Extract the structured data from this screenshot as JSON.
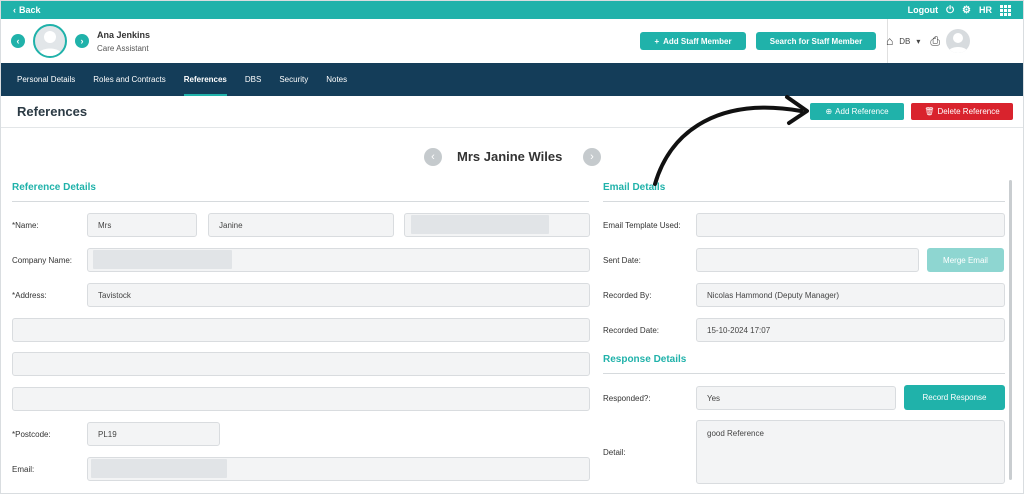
{
  "topbar": {
    "back_label": "Back",
    "logout_label": "Logout",
    "hr_label": "HR"
  },
  "header": {
    "user_name": "Ana Jenkins",
    "user_role": "Care Assistant",
    "add_staff_label": "Add Staff Member",
    "search_staff_label": "Search for Staff Member",
    "db_label": "DB"
  },
  "nav": {
    "tabs": [
      {
        "label": "Personal Details"
      },
      {
        "label": "Roles and Contracts"
      },
      {
        "label": "References",
        "active": true
      },
      {
        "label": "DBS"
      },
      {
        "label": "Security"
      },
      {
        "label": "Notes"
      }
    ]
  },
  "page": {
    "title": "References",
    "add_reference_label": "Add Reference",
    "delete_reference_label": "Delete Reference",
    "reference_name": "Mrs Janine Wiles"
  },
  "reference_details": {
    "section_title": "Reference Details",
    "name_label": "*Name:",
    "title_value": "Mrs",
    "first_name_value": "Janine",
    "company_label": "Company Name:",
    "address_label": "*Address:",
    "address_line1": "Tavistock",
    "postcode_label": "*Postcode:",
    "postcode_value": "PL19",
    "email_label": "Email:"
  },
  "email_details": {
    "section_title": "Email Details",
    "template_label": "Email Template Used:",
    "sent_date_label": "Sent Date:",
    "merge_label": "Merge Email",
    "recorded_by_label": "Recorded By:",
    "recorded_by_value": "Nicolas Hammond (Deputy Manager)",
    "recorded_date_label": "Recorded Date:",
    "recorded_date_value": "15-10-2024 17:07"
  },
  "response_details": {
    "section_title": "Response Details",
    "responded_label": "Responded?:",
    "responded_value": "Yes",
    "record_response_label": "Record Response",
    "detail_label": "Detail:",
    "detail_value": "good Reference"
  },
  "colors": {
    "teal": "#20b2aa",
    "navy": "#143d59",
    "red": "#d9232d"
  }
}
